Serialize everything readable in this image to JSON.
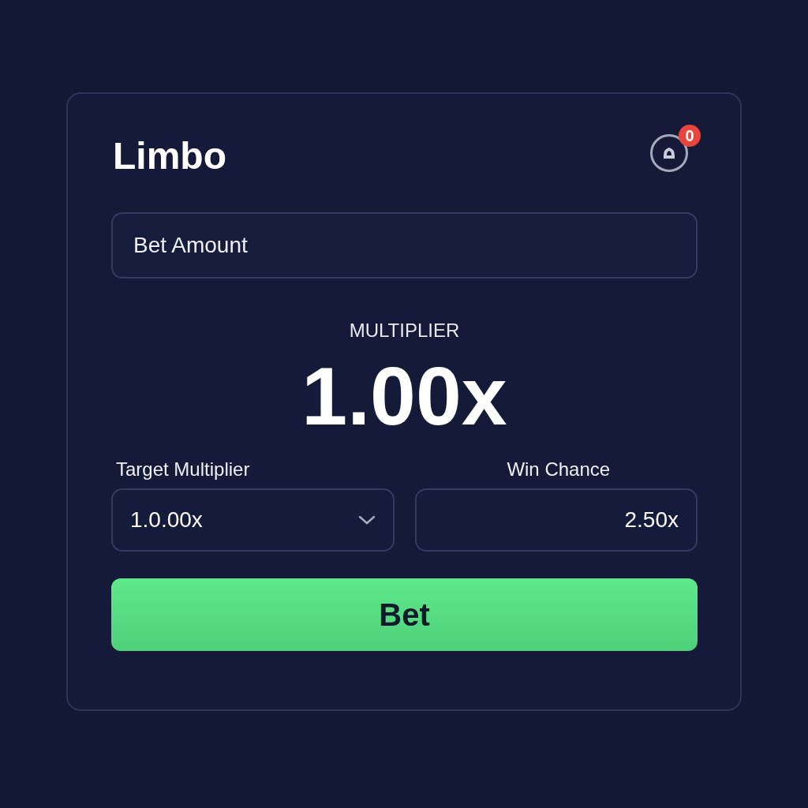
{
  "title": "Limbo",
  "notification": {
    "badge": "0"
  },
  "bet_amount": {
    "placeholder": "Bet Amount"
  },
  "multiplier": {
    "label": "MULTIPLIER",
    "value": "1.00x"
  },
  "fields": [
    {
      "kind": "dropdown",
      "label": "Target Multiplier",
      "value": "1.0.00x"
    },
    {
      "kind": "text",
      "label": "Win Chance",
      "value": "2.50x"
    }
  ],
  "button": "Bet"
}
